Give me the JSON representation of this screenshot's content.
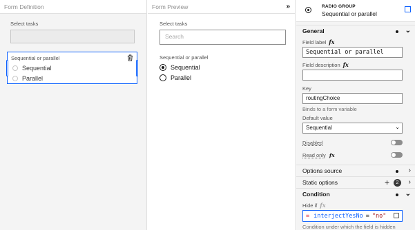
{
  "definition": {
    "header": "Form Definition",
    "tasks_label": "Select tasks",
    "radio": {
      "label": "Sequential or parallel",
      "options": [
        "Sequential",
        "Parallel"
      ]
    }
  },
  "preview": {
    "header": "Form Preview",
    "collapse_glyph": "»",
    "tasks_label": "Select tasks",
    "search_placeholder": "Search",
    "radio": {
      "label": "Sequential or parallel",
      "options": [
        "Sequential",
        "Parallel"
      ],
      "selected": "Sequential"
    }
  },
  "properties": {
    "type": "RADIO GROUP",
    "name": "Sequential or parallel",
    "general": {
      "title": "General",
      "field_label_label": "Field label",
      "field_label_value": "Sequential or parallel",
      "field_description_label": "Field description",
      "fx": "fx",
      "key_label": "Key",
      "key_value": "routingChoice",
      "key_hint": "Binds to a form variable",
      "default_label": "Default value",
      "default_value": "Sequential",
      "disabled_label": "Disabled",
      "readonly_label": "Read only"
    },
    "options_source": {
      "title": "Options source"
    },
    "static_options": {
      "title": "Static options",
      "count": "2"
    },
    "condition": {
      "title": "Condition",
      "hide_if_label": "Hide if",
      "fx": "fx",
      "expr_eq": "=",
      "expr_ident": "interjectYesNo",
      "expr_op": "=",
      "expr_str": "\"no\"",
      "hint": "Condition under which the field is hidden"
    }
  }
}
